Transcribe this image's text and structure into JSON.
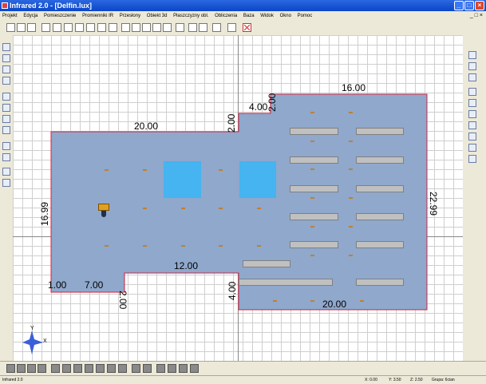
{
  "window": {
    "title": "Infrared 2.0 - [Delfin.lux]",
    "min": "_",
    "max": "□",
    "close": "×"
  },
  "menu": {
    "items": [
      "Projekt",
      "Edycja",
      "Pomieszczenie",
      "Promienniki IR",
      "Przesłony",
      "Obiekt 3d",
      "Płaszczyzny obl.",
      "Obliczenia",
      "Baza",
      "Widok",
      "Okno",
      "Pomoc"
    ],
    "mdi_controls": "_ □ ×"
  },
  "drawing": {
    "dimensions": {
      "top_left": "20.00",
      "notch_width": "4.00",
      "notch_height": "2.00",
      "step_height": "2.00",
      "top_right": "16.00",
      "left_height": "16.99",
      "right_height": "22.99",
      "inner_width": "12.00",
      "bottom_step_width": "7.00",
      "bottom_step_partial": "1.00",
      "inner_step_height": "2.00",
      "bottom_inner_height": "4.00",
      "bottom_right": "20.00"
    },
    "compass": {
      "x": "X",
      "y": "Y"
    },
    "colors": {
      "floor": "#8fa8cc",
      "outline": "#d02040",
      "window": "#45b4f0",
      "heater": "#c0c0c0"
    }
  },
  "status": {
    "app": "Infrared 2.0",
    "x": "X: 0.00",
    "y": "Y: 3.50",
    "z": "Z: 2.50",
    "group": "Grupa: 6cian"
  }
}
